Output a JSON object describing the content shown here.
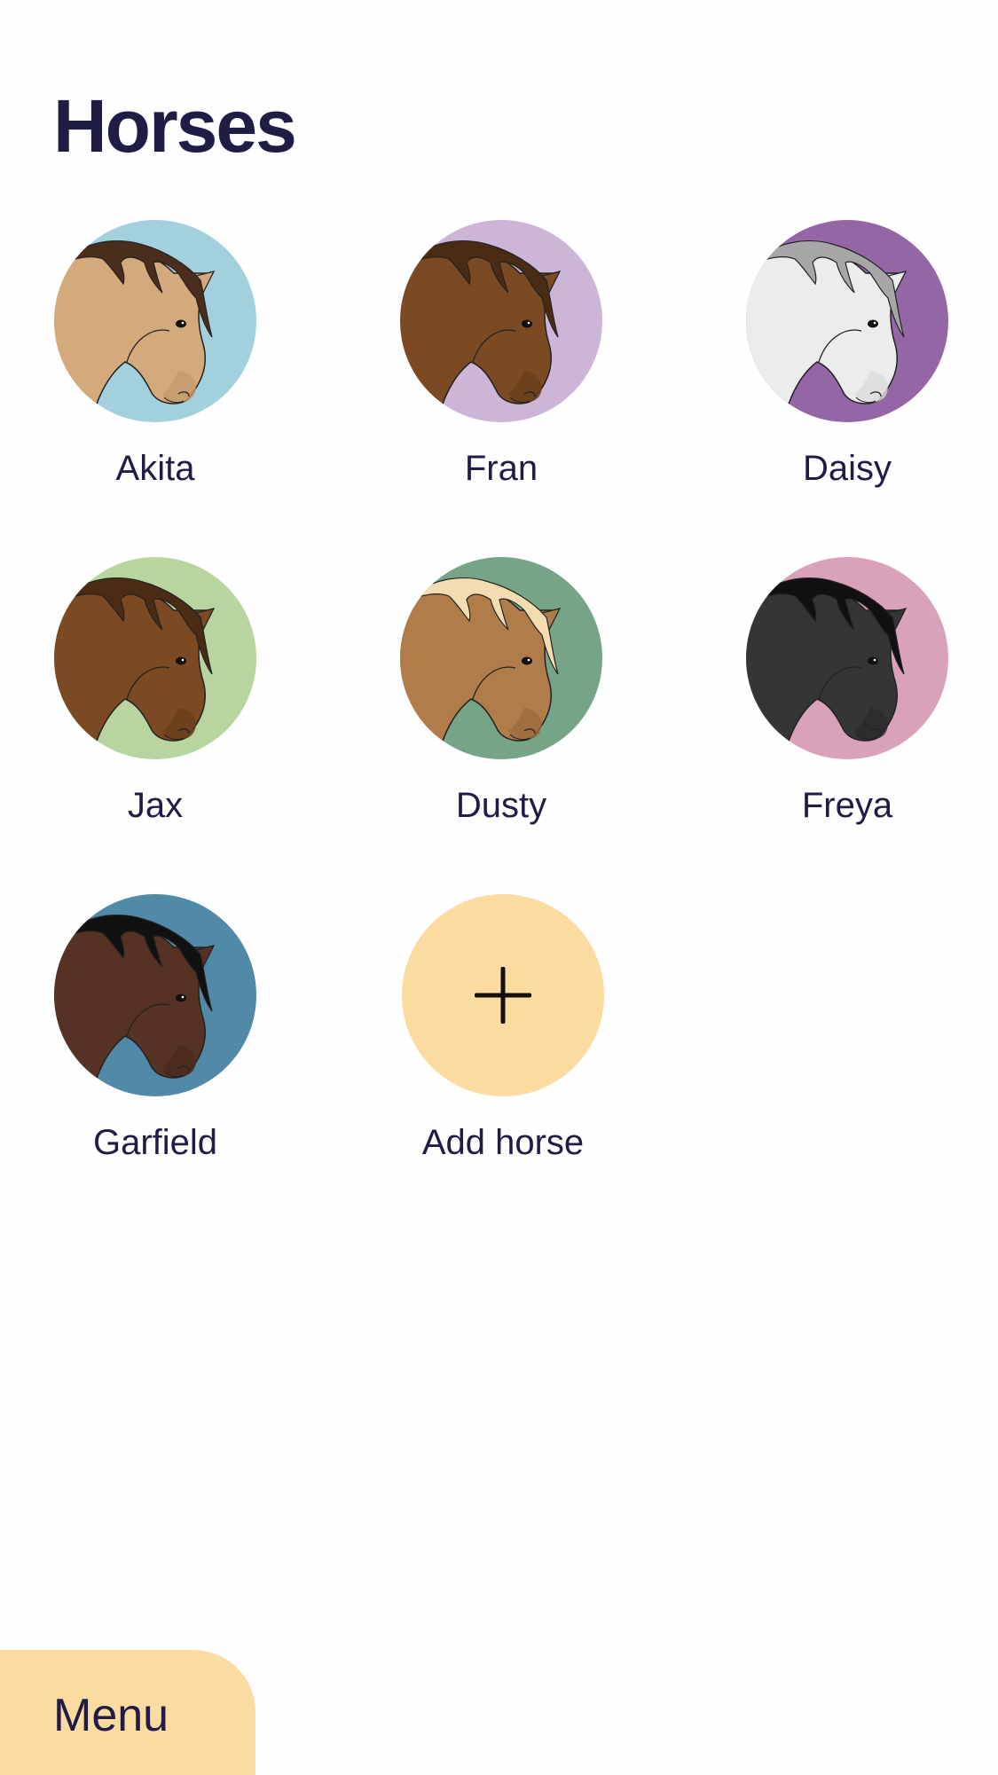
{
  "header": {
    "title": "Horses"
  },
  "colors": {
    "text": "#1f1d45",
    "accent": "#fbdb9f",
    "outline": "#222222"
  },
  "horses": [
    {
      "name": "Akita",
      "bg": "#a3d0dd",
      "coat": "#d4aa7c",
      "mane": "#4a2e1b",
      "muzzle": "#c49a6c"
    },
    {
      "name": "Fran",
      "bg": "#cdb5d7",
      "coat": "#7b4a23",
      "mane": "#4a2c14",
      "muzzle": "#6b3e1c"
    },
    {
      "name": "Daisy",
      "bg": "#9566a6",
      "coat": "#ececec",
      "mane": "#a6a6a6",
      "muzzle": "#dcdcdc"
    },
    {
      "name": "Jax",
      "bg": "#b8d59f",
      "coat": "#7b4a23",
      "mane": "#4a2c14",
      "muzzle": "#6b3e1c"
    },
    {
      "name": "Dusty",
      "bg": "#75a586",
      "coat": "#b07d4a",
      "mane": "#f3dcb0",
      "muzzle": "#9c6c3c"
    },
    {
      "name": "Freya",
      "bg": "#daa2ba",
      "coat": "#353535",
      "mane": "#111111",
      "muzzle": "#2a2a2a"
    },
    {
      "name": "Garfield",
      "bg": "#508aa6",
      "coat": "#553223",
      "mane": "#111111",
      "muzzle": "#4a2b1d"
    }
  ],
  "add_horse": {
    "label": "Add horse",
    "icon": "plus-icon",
    "bg": "#fbdb9f"
  },
  "menu": {
    "label": "Menu",
    "bg": "#fbdb9f"
  }
}
